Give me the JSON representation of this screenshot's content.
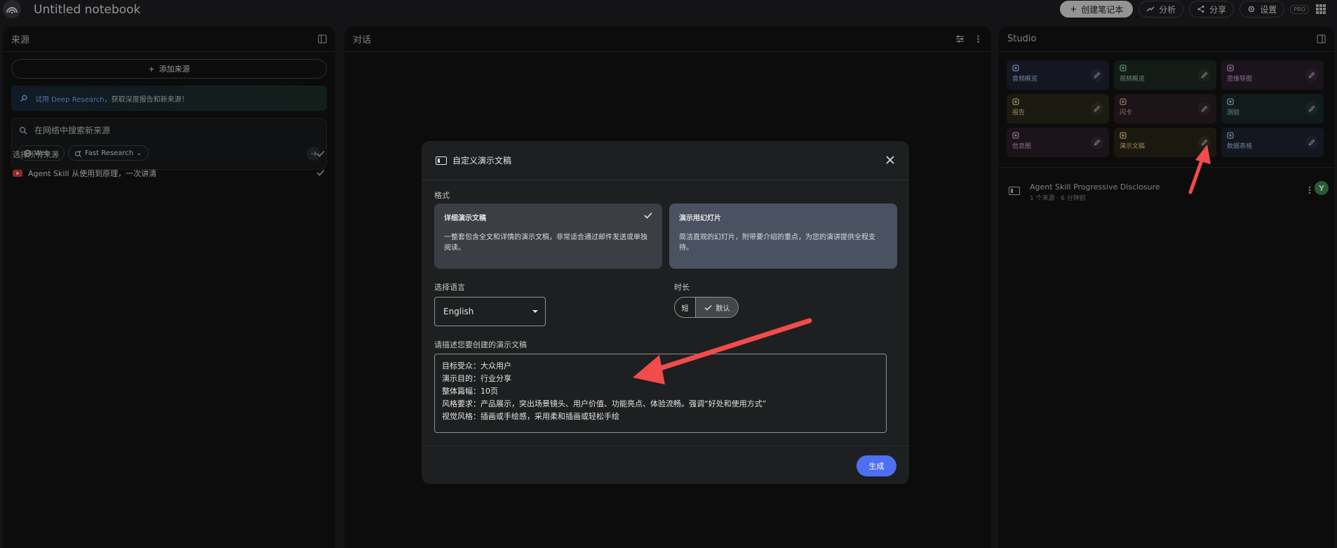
{
  "topbar": {
    "title": "Untitled notebook",
    "create_label": "创建笔记本",
    "analytics_label": "分析",
    "share_label": "分享",
    "settings_label": "设置",
    "pro_badge": "PRO"
  },
  "sources": {
    "title": "来源",
    "add_label": "添加来源",
    "deep_research_link": "试用 Deep Research",
    "deep_research_text": "，获取深度报告和新来源！",
    "search_placeholder": "在网络中搜索新来源",
    "chip_web": "Web",
    "chip_research": "Fast Research",
    "select_all": "选择所有来源",
    "items": [
      {
        "label": "Agent Skill 从使用到原理，一次讲清"
      }
    ]
  },
  "chat": {
    "title": "对话"
  },
  "studio": {
    "title": "Studio",
    "tiles": [
      {
        "label": "音频概览",
        "color": "#1f2433",
        "text": "#a8c7fa"
      },
      {
        "label": "视频概览",
        "color": "#1e2a22",
        "text": "#9bd1a8"
      },
      {
        "label": "思维导图",
        "color": "#2a1f2c",
        "text": "#d7a8e0"
      },
      {
        "label": "报告",
        "color": "#2a2a1c",
        "text": "#e0d38c"
      },
      {
        "label": "闪卡",
        "color": "#2c1f22",
        "text": "#f2a8a8"
      },
      {
        "label": "测验",
        "color": "#1c2a2a",
        "text": "#9fd3d3"
      },
      {
        "label": "信息图",
        "color": "#2a1f2a",
        "text": "#e0a8d4"
      },
      {
        "label": "演示文稿",
        "color": "#2a2718",
        "text": "#e8d28c"
      },
      {
        "label": "数据表格",
        "color": "#1f2430",
        "text": "#a8c0e8"
      }
    ],
    "note": {
      "title": "Agent Skill Progressive Disclosure",
      "meta": "1 个来源 · 6 分钟前",
      "avatar": "Y"
    }
  },
  "modal": {
    "title": "自定义演示文稿",
    "format_label": "格式",
    "formats": [
      {
        "title": "详细演示文稿",
        "desc": "一整套包含全文和详情的演示文稿，非常适合通过邮件发送或单独阅读。",
        "selected": true
      },
      {
        "title": "演示用幻灯片",
        "desc": "简洁直观的幻灯片，附带要介绍的重点，为您的演讲提供全程支持。",
        "selected": false
      }
    ],
    "language_label": "选择语言",
    "language_value": "English",
    "duration_label": "时长",
    "duration_short": "短",
    "duration_default": "默认",
    "describe_label": "请描述您要创建的演示文稿",
    "describe_lines": [
      "目标受众：大众用户",
      "演示目的：行业分享",
      "整体篇幅：10页",
      "风格要求：产品展示，突出场景镜头、用户价值、功能亮点、体验流畅。强调“好处和使用方式”",
      "视觉风格：插画或手绘感，采用柔和插画或轻松手绘"
    ],
    "generate_label": "生成"
  },
  "colors": {
    "accent": "#4f6ff2",
    "annotation_arrow": "#f14b4b"
  }
}
